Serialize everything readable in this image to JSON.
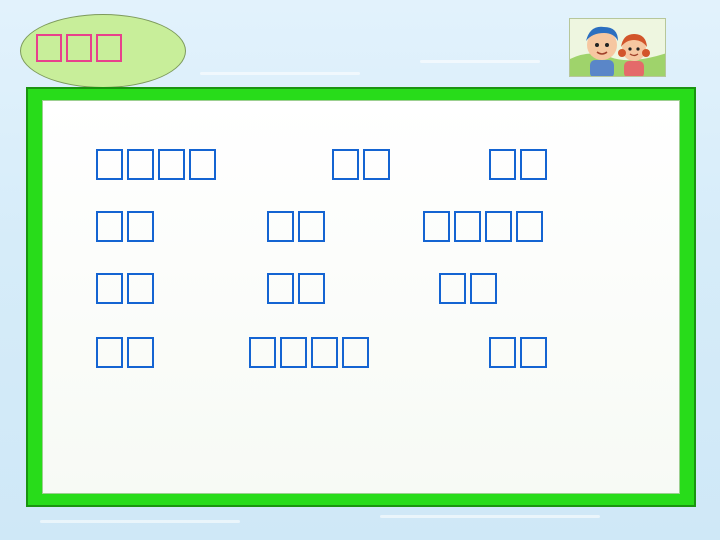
{
  "title": {
    "glyph_count": 3,
    "color": "#e8408c"
  },
  "board": {
    "frame_color": "#28dc1a",
    "glyph_color": "#1464d2",
    "rows": [
      [
        {
          "glyphs": 4
        },
        {
          "glyphs": 2
        },
        {
          "glyphs": 2
        }
      ],
      [
        {
          "glyphs": 2
        },
        {
          "glyphs": 2
        },
        {
          "glyphs": 4
        }
      ],
      [
        {
          "glyphs": 2
        },
        {
          "glyphs": 2
        },
        {
          "glyphs": 2
        }
      ],
      [
        {
          "glyphs": 2
        },
        {
          "glyphs": 4
        },
        {
          "glyphs": 2
        }
      ]
    ]
  },
  "icons": {
    "kids": "boy-and-girl-cartoon-icon"
  }
}
